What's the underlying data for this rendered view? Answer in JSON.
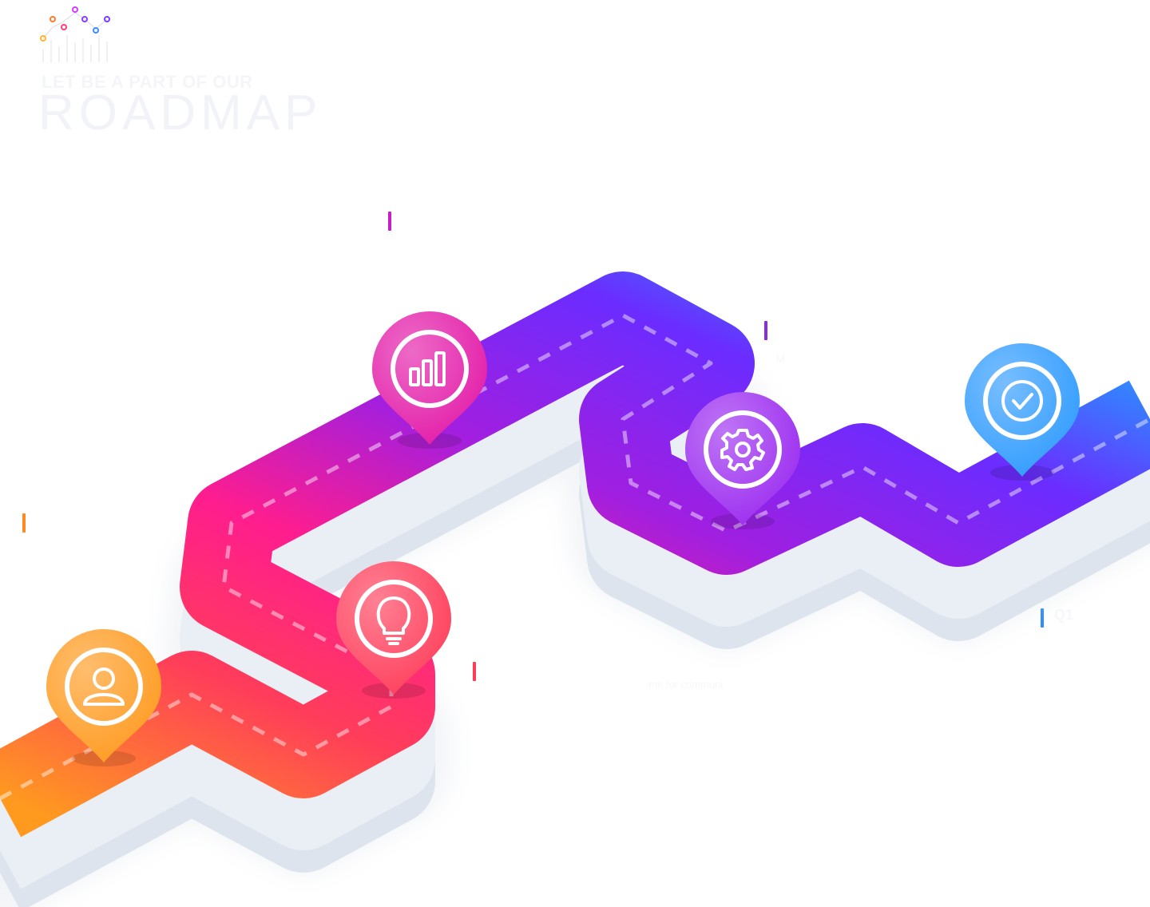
{
  "header": {
    "tagline": "LET BE A PART OF OUR",
    "headline": "ROADMAP"
  },
  "colors": {
    "orange": "#ff9a1f",
    "red": "#ff3d5a",
    "pink": "#ff1d8e",
    "purple": "#8a2be2",
    "violet": "#6b2cff",
    "blue": "#1fb5ff"
  },
  "milestones": [
    {
      "icon": "user-icon",
      "color": "#ff9a1f"
    },
    {
      "icon": "lightbulb-icon",
      "color": "#ff3d5a"
    },
    {
      "icon": "bar-chart-icon",
      "color": "#e31aa8"
    },
    {
      "icon": "gear-icon",
      "color": "#9b2bf0"
    },
    {
      "icon": "check-circle-icon",
      "color": "#2f9bff"
    }
  ],
  "faint_text": {
    "comm": "me for communi",
    "q": "Q1",
    "m": "M"
  }
}
